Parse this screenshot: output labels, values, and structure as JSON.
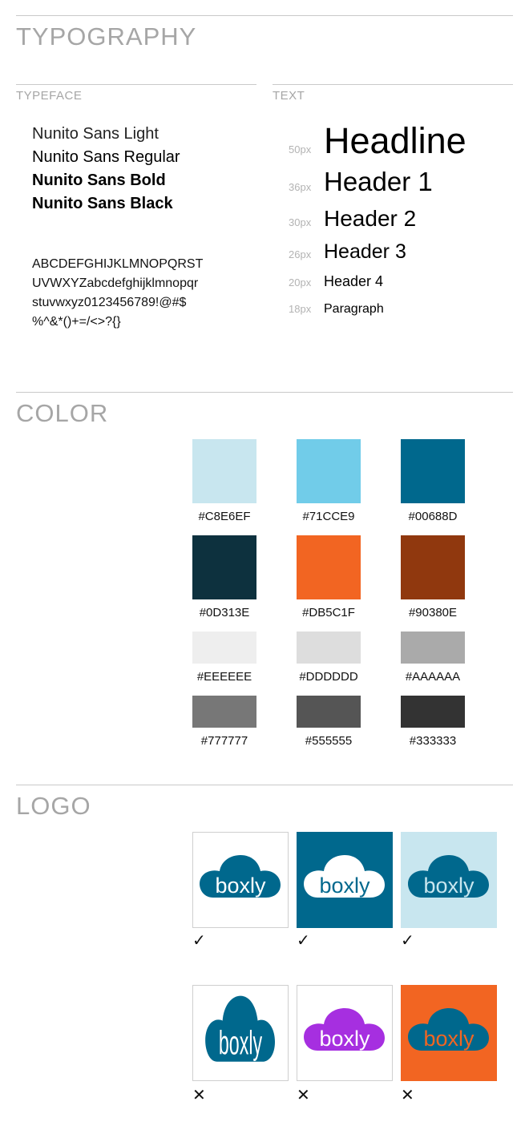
{
  "typography": {
    "title": "TYPOGRAPHY",
    "typeface_label": "TYPEFACE",
    "text_label": "TEXT",
    "typefaces": [
      "Nunito Sans Light",
      "Nunito Sans Regular",
      "Nunito Sans Bold",
      "Nunito Sans Black"
    ],
    "charset": [
      "ABCDEFGHIJKLMNOPQRST",
      "UVWXYZabcdefghijklmnopqr",
      "stuvwxyz0123456789!@#$",
      "%^&*()+=/<>?{}"
    ],
    "samples": [
      {
        "size": "50px",
        "label": "Headline"
      },
      {
        "size": "36px",
        "label": "Header 1"
      },
      {
        "size": "30px",
        "label": "Header 2"
      },
      {
        "size": "26px",
        "label": "Header 3"
      },
      {
        "size": "20px",
        "label": "Header 4"
      },
      {
        "size": "18px",
        "label": "Paragraph"
      }
    ]
  },
  "color": {
    "title": "COLOR",
    "swatches": [
      {
        "hex": "#C8E6EF",
        "color": "#C8E6EF"
      },
      {
        "hex": "#71CCE9",
        "color": "#71CCE9"
      },
      {
        "hex": "#00688D",
        "color": "#00688D"
      },
      {
        "hex": "#0D313E",
        "color": "#0D313E"
      },
      {
        "hex": "#DB5C1F",
        "color": "#F26522"
      },
      {
        "hex": "#90380E",
        "color": "#90380E"
      },
      {
        "hex": "#EEEEEE",
        "color": "#EEEEEE"
      },
      {
        "hex": "#DDDDDD",
        "color": "#DDDDDD"
      },
      {
        "hex": "#AAAAAA",
        "color": "#AAAAAA"
      },
      {
        "hex": "#777777",
        "color": "#777777"
      },
      {
        "hex": "#555555",
        "color": "#555555"
      },
      {
        "hex": "#333333",
        "color": "#333333"
      }
    ]
  },
  "logo": {
    "title": "LOGO",
    "brand": "boxly",
    "correct_mark": "✓",
    "wrong_mark": "✕",
    "tiles": [
      {
        "bg": "#ffffff",
        "cloud": "#00688D",
        "text": "#ffffff",
        "valid": true
      },
      {
        "bg": "#00688D",
        "cloud": "#ffffff",
        "text": "#00688D",
        "valid": true
      },
      {
        "bg": "#C8E6EF",
        "cloud": "#00688D",
        "text": "#C8E6EF",
        "valid": true
      },
      {
        "bg": "#ffffff",
        "cloud": "#00688D",
        "text": "#ffffff",
        "valid": false,
        "variant": "stretched"
      },
      {
        "bg": "#ffffff",
        "cloud": "#A62FE0",
        "text": "#ffffff",
        "valid": false,
        "variant": "wrong-color"
      },
      {
        "bg": "#F26522",
        "cloud": "#00688D",
        "text": "#F26522",
        "valid": false,
        "variant": "low-contrast"
      }
    ]
  }
}
